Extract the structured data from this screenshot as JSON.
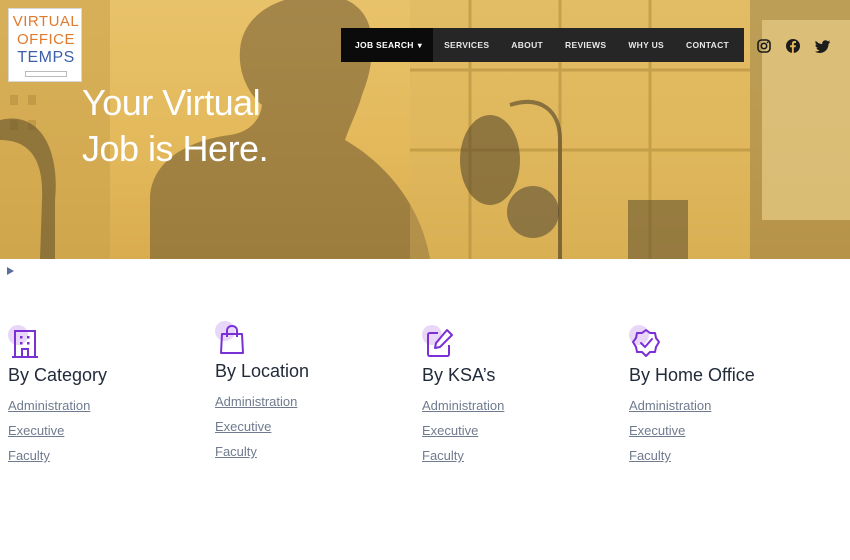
{
  "brand": {
    "logo_line1": "VIRTUAL",
    "logo_line2": "OFFICE",
    "logo_line3": "TEMPS"
  },
  "nav": {
    "items": [
      {
        "label": "JOB SEARCH",
        "has_dropdown": true,
        "active": true
      },
      {
        "label": "SERVICES"
      },
      {
        "label": "ABOUT"
      },
      {
        "label": "REVIEWS"
      },
      {
        "label": "WHY US"
      },
      {
        "label": "CONTACT"
      }
    ]
  },
  "social": [
    "instagram-icon",
    "facebook-icon",
    "twitter-icon"
  ],
  "hero": {
    "title_line1": "Your Virtual",
    "title_line2": "Job is Here."
  },
  "categories": [
    {
      "icon": "building-icon",
      "heading": "By Category",
      "links": [
        "Administration",
        "Executive",
        "Faculty"
      ]
    },
    {
      "icon": "shopping-bag-icon",
      "heading": "By Location",
      "links": [
        "Administration",
        "Executive",
        "Faculty"
      ]
    },
    {
      "icon": "edit-icon",
      "heading": "By KSA’s",
      "links": [
        "Administration",
        "Executive",
        "Faculty"
      ]
    },
    {
      "icon": "verified-badge-icon",
      "heading": "By Home Office",
      "links": [
        "Administration",
        "Executive",
        "Faculty"
      ]
    }
  ],
  "colors": {
    "hero_tint": "#e3b95b",
    "nav_bg": "#262626",
    "icon_accent": "#7b2fd6",
    "heading": "#222b3a",
    "link": "#707b8f"
  }
}
